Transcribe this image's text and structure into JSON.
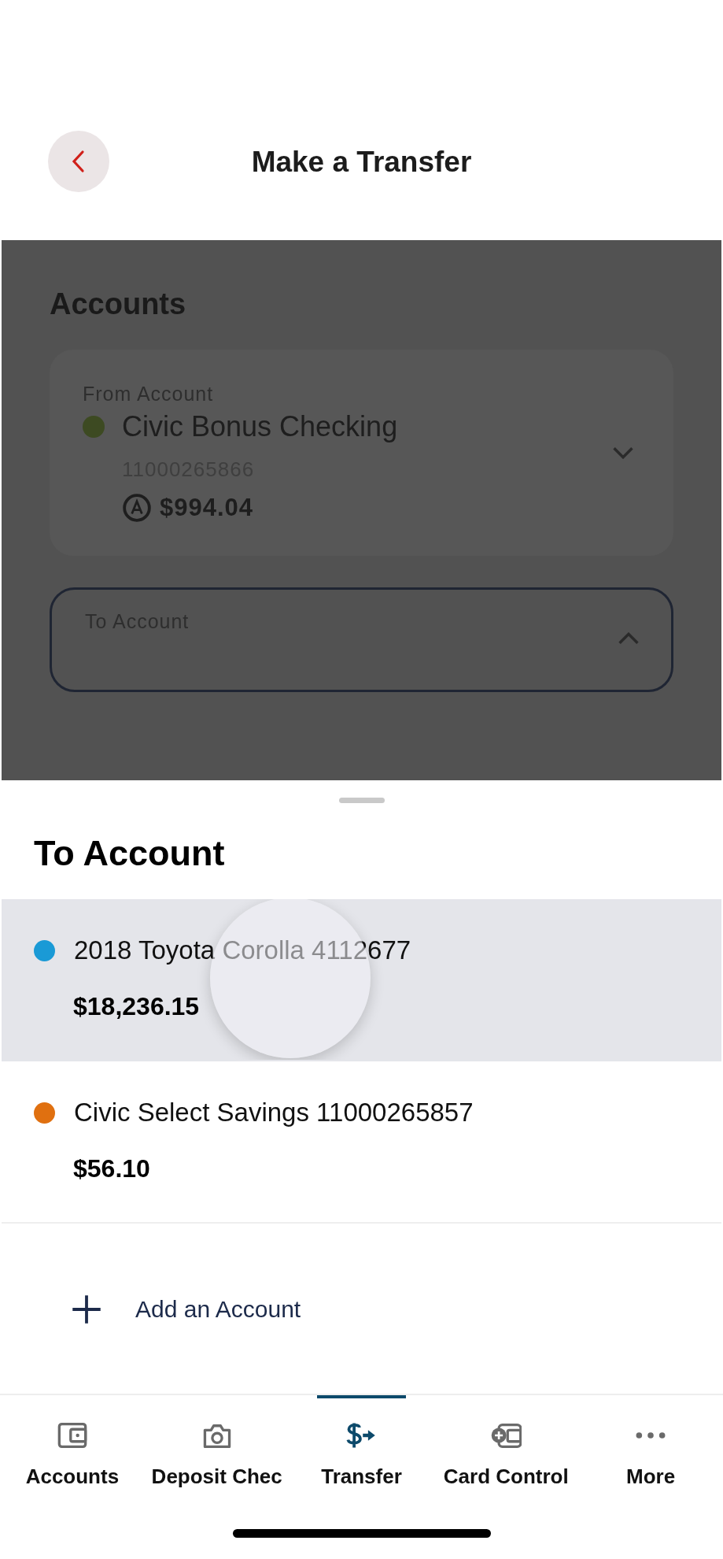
{
  "header": {
    "title": "Make a Transfer"
  },
  "form": {
    "section_title": "Accounts",
    "from_account": {
      "label": "From Account",
      "name": "Civic Bonus Checking",
      "number": "11000265866",
      "balance": "$994.04"
    },
    "to_account": {
      "label": "To Account",
      "expanded": true
    }
  },
  "sheet": {
    "title": "To Account",
    "accounts": [
      {
        "name": "2018 Toyota Corolla 4112677",
        "balance": "$18,236.15",
        "color": "#1a9ad6",
        "selected": true
      },
      {
        "name": "Civic Select Savings 11000265857",
        "balance": "$56.10",
        "color": "#e07010",
        "selected": false
      }
    ],
    "add_action": "Add an Account"
  },
  "tab_bar": [
    {
      "label": "Accounts",
      "selected": false
    },
    {
      "label": "Deposit Chec",
      "selected": false
    },
    {
      "label": "Transfer",
      "selected": true
    },
    {
      "label": "Card Control",
      "selected": false
    },
    {
      "label": "More",
      "selected": false
    }
  ]
}
